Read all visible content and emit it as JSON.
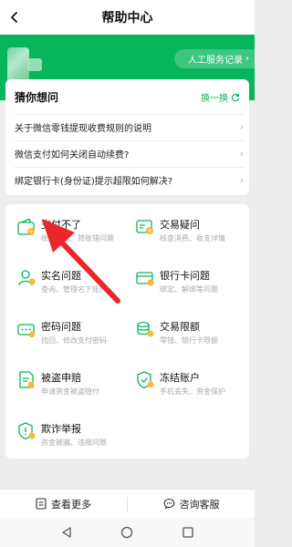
{
  "nav": {
    "title": "帮助中心"
  },
  "header": {
    "service_label": "人工服务记录"
  },
  "guess": {
    "title": "猜你想问",
    "refresh_label": "换一换",
    "questions": [
      "关于微信零钱提现收费规则的说明",
      "微信支付如何关闭自动续费?",
      "绑定银行卡(身份证)提示超限如何解决?"
    ]
  },
  "grid": {
    "items": [
      {
        "title": "支付不了",
        "sub": "账户受限、转账错问题",
        "icon": "wallet-icon"
      },
      {
        "title": "交易疑问",
        "sub": "核查消费、收支详情",
        "icon": "transaction-icon"
      },
      {
        "title": "实名问题",
        "sub": "查询、管理名下账户",
        "icon": "person-icon"
      },
      {
        "title": "银行卡问题",
        "sub": "绑定、解绑等问题",
        "icon": "bank-card-icon"
      },
      {
        "title": "密码问题",
        "sub": "找回、修改支付密码",
        "icon": "password-icon"
      },
      {
        "title": "交易限额",
        "sub": "零钱、银行卡限额",
        "icon": "limit-coins-icon"
      },
      {
        "title": "被盗申赔",
        "sub": "申请资金被盗赔付",
        "icon": "theft-claim-icon"
      },
      {
        "title": "冻结账户",
        "sub": "手机丢失、资金保护",
        "icon": "shield-freeze-icon"
      },
      {
        "title": "欺诈举报",
        "sub": "资金被骗、违规问题",
        "icon": "fraud-report-icon"
      }
    ]
  },
  "bottom": {
    "more_label": "查看更多",
    "service_label": "咨询客服"
  },
  "colors": {
    "brand_green": "#07b65a",
    "arrow_red": "#e8262b"
  }
}
